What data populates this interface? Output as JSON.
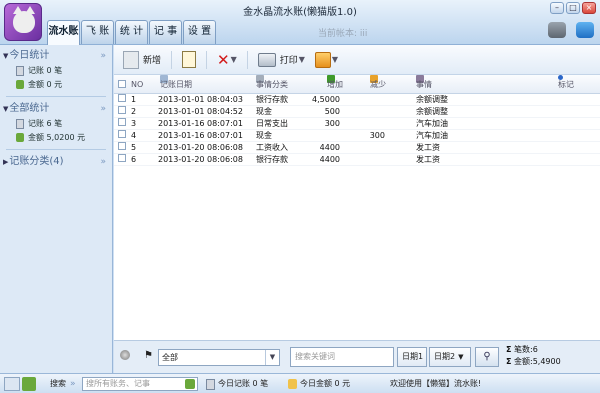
{
  "window": {
    "title": "金水晶流水账(懒猫版1.0)",
    "account_label": "当前帐本: iii",
    "controls": [
      "–",
      "□",
      "×"
    ]
  },
  "tabs": [
    {
      "label": "流水账",
      "active": true
    },
    {
      "label": "飞 账"
    },
    {
      "label": "统 计"
    },
    {
      "label": "记 事"
    },
    {
      "label": "设 置"
    }
  ],
  "sidebar": {
    "today": {
      "title": "今日统计",
      "records": "记账 0 笔",
      "amount": "金额 0 元"
    },
    "all": {
      "title": "全部统计",
      "records": "记账 6 笔",
      "amount": "金额 5,0200 元"
    },
    "categories": {
      "title": "记账分类(4)"
    }
  },
  "toolbar": {
    "new": "新增",
    "print": "打印"
  },
  "table": {
    "headers": {
      "no": "NO",
      "date": "记账日期",
      "category": "事情分类",
      "increase": "增加",
      "decrease": "减少",
      "matter": "事情",
      "mark": "标记"
    },
    "rows": [
      {
        "no": "1",
        "date": "2013-01-01 08:04:03",
        "category": "银行存款",
        "increase": "4,5000",
        "decrease": "",
        "matter": "余额调整"
      },
      {
        "no": "2",
        "date": "2013-01-01 08:04:52",
        "category": "现金",
        "increase": "500",
        "decrease": "",
        "matter": "余额调整"
      },
      {
        "no": "3",
        "date": "2013-01-16 08:07:01",
        "category": "日常支出",
        "increase": "300",
        "decrease": "",
        "matter": "汽车加油"
      },
      {
        "no": "4",
        "date": "2013-01-16 08:07:01",
        "category": "现金",
        "increase": "",
        "decrease": "300",
        "matter": "汽车加油"
      },
      {
        "no": "5",
        "date": "2013-01-20 08:06:08",
        "category": "工资收入",
        "increase": "4400",
        "decrease": "",
        "matter": "发工资"
      },
      {
        "no": "6",
        "date": "2013-01-20 08:06:08",
        "category": "银行存款",
        "increase": "4400",
        "decrease": "",
        "matter": "发工资"
      }
    ]
  },
  "filter": {
    "selected": "全部",
    "search_placeholder": "搜索关键词",
    "date1": "日期1",
    "date2": "日期2",
    "count": "笔数:6",
    "total": "金额:5,4900"
  },
  "statusbar": {
    "search_label": "搜索",
    "search_placeholder": "搜所有账务、记事",
    "today_records": "今日记账 0 笔",
    "today_amount": "今日金额 0 元",
    "welcome": "欢迎使用【懒猫】流水账!"
  },
  "colors": {
    "accent": "#4a6890",
    "increase_icon": "#3f9a2a",
    "decrease_icon": "#e8a22a",
    "mark_dot": "#2a66c8"
  }
}
